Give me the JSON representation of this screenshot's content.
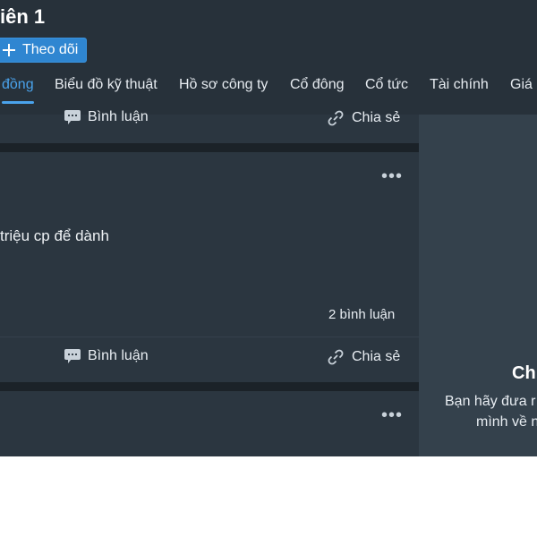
{
  "header": {
    "title": "iên 1",
    "follow_label": "Theo dõi"
  },
  "tabs": [
    {
      "label": "đồng",
      "active": true
    },
    {
      "label": "Biểu đồ kỹ thuật",
      "active": false
    },
    {
      "label": "Hồ sơ công ty",
      "active": false
    },
    {
      "label": "Cổ đông",
      "active": false
    },
    {
      "label": "Cổ tức",
      "active": false
    },
    {
      "label": "Tài chính",
      "active": false
    },
    {
      "label": "Giá",
      "active": false
    }
  ],
  "feed": {
    "actions_top": {
      "comment_label": "Bình luận",
      "share_label": "Chia sẻ"
    },
    "post": {
      "text": "triệu cp để dành",
      "comments_count": "2 bình luận",
      "comment_label": "Bình luận",
      "share_label": "Chia sẻ"
    }
  },
  "sidebar": {
    "title": "Ch",
    "line1": "Bạn hãy đưa r",
    "line2": "mình về n"
  },
  "colors": {
    "accent": "#4aa3ec",
    "follow_button": "#2f86d1",
    "background": "#2b3640",
    "sidebar": "#34414c"
  }
}
